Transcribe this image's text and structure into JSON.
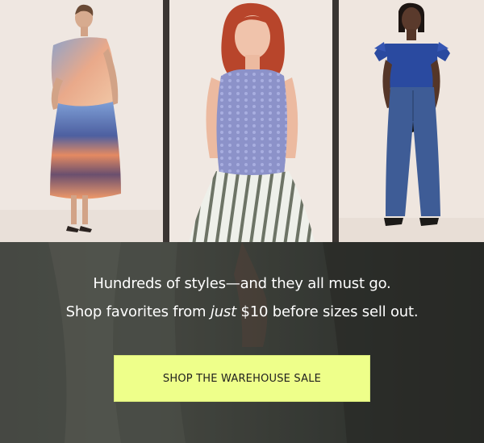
{
  "hero": {
    "panels": [
      {
        "name": "model-orange-sunset-dress"
      },
      {
        "name": "model-lavender-knit-top"
      },
      {
        "name": "model-navy-top-denim"
      }
    ]
  },
  "promo": {
    "headline_line1": "Hundreds of styles—and they all must go.",
    "headline_line2_pre": "Shop favorites from ",
    "headline_line2_em": "just",
    "headline_line2_post": " $10 before sizes sell out.",
    "cta_label": "SHOP THE WAREHOUSE SALE"
  },
  "colors": {
    "cta_background": "#eeff8a",
    "text_light": "#ffffff",
    "cta_text": "#1e1e1e"
  }
}
